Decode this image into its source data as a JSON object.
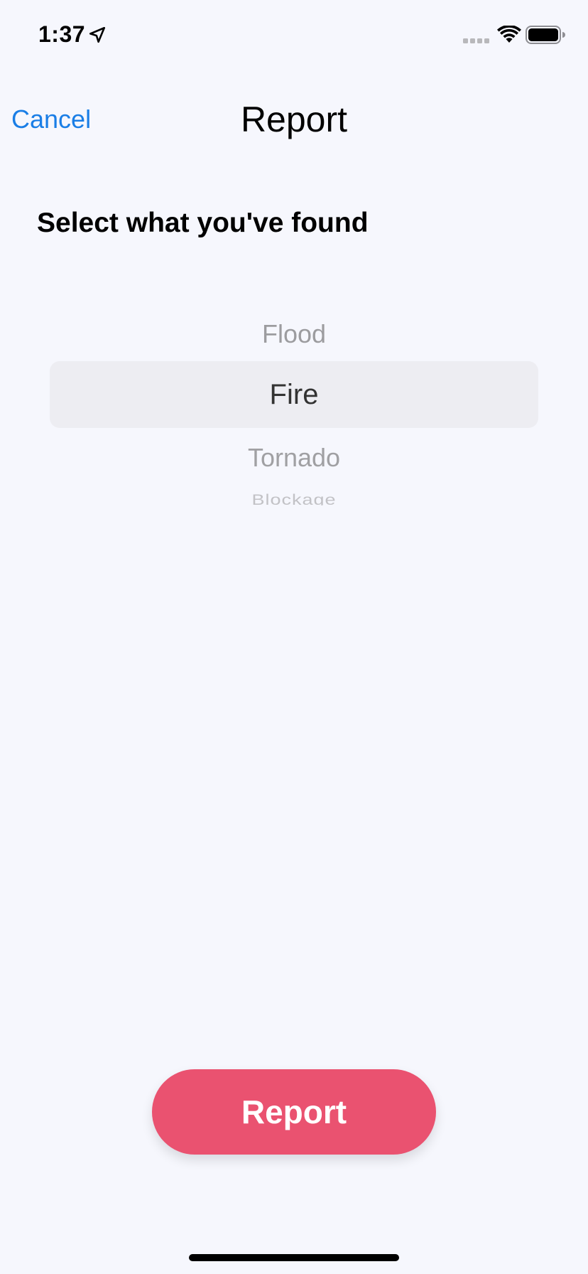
{
  "status_bar": {
    "time": "1:37",
    "location_icon": "location-arrow-icon",
    "signal_icon": "cellular-signal-icon",
    "wifi_icon": "wifi-icon",
    "battery_icon": "battery-icon"
  },
  "nav": {
    "cancel_label": "Cancel",
    "title": "Report"
  },
  "section": {
    "heading": "Select what you've found"
  },
  "picker": {
    "items": [
      "Flood",
      "Fire",
      "Tornado",
      "Blockage"
    ],
    "selected": "Fire"
  },
  "actions": {
    "report_label": "Report"
  },
  "colors": {
    "accent": "#1a7ee6",
    "report_button": "#ea5270",
    "background": "#f6f7fd",
    "picker_highlight": "#ededf2"
  }
}
